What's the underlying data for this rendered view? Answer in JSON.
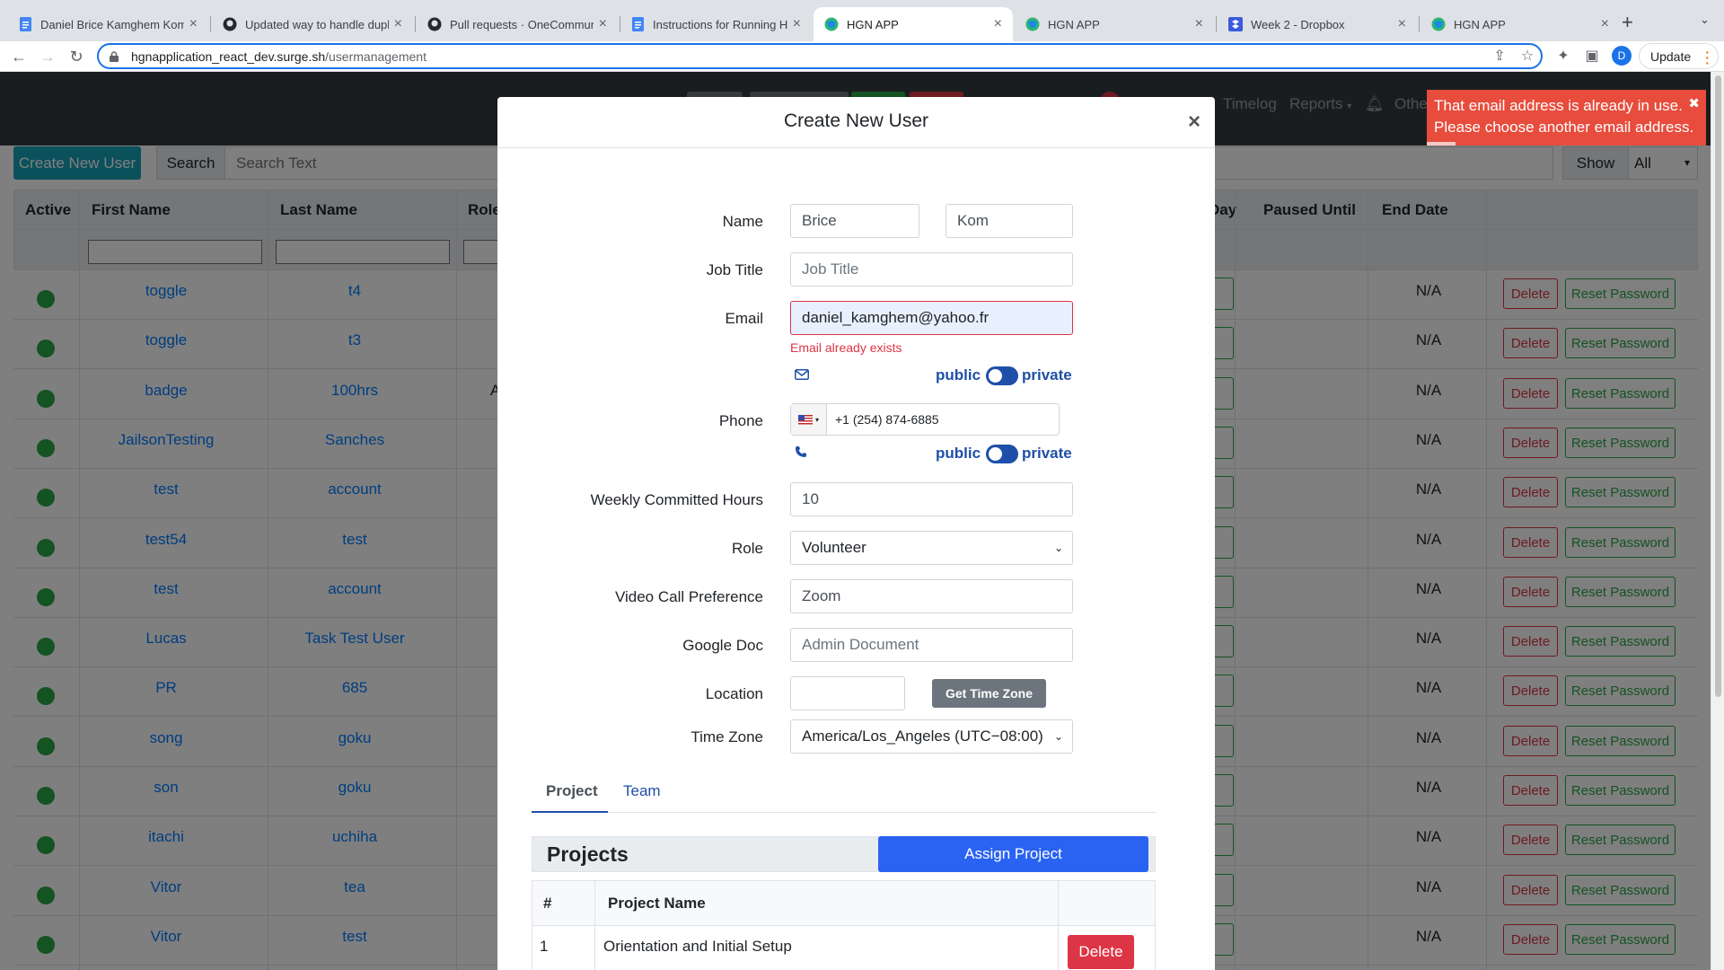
{
  "browser": {
    "tabs": [
      {
        "title": "Daniel Brice Kamghem Kom",
        "icon": "google-docs-icon",
        "active": false
      },
      {
        "title": "Updated way to handle dupl",
        "icon": "github-icon",
        "active": false
      },
      {
        "title": "Pull requests · OneCommuni",
        "icon": "github-icon",
        "active": false
      },
      {
        "title": "Instructions for Running HGI",
        "icon": "google-docs-icon",
        "active": false
      },
      {
        "title": "HGN APP",
        "icon": "hgn-globe-icon",
        "active": true
      },
      {
        "title": "HGN APP",
        "icon": "hgn-globe-icon",
        "active": false
      },
      {
        "title": "Week 2 - Dropbox",
        "icon": "dropbox-icon",
        "active": false
      },
      {
        "title": "HGN APP",
        "icon": "hgn-globe-icon",
        "active": false
      }
    ],
    "url_host": "hgnapplication_react_dev.surge.sh",
    "url_path": "/usermanagement",
    "profile_initial": "D",
    "update_label": "Update"
  },
  "nav": {
    "links": [
      "Timelog",
      "Reports",
      "Othe"
    ]
  },
  "controls": {
    "create_label": "Create New User",
    "search_label": "Search",
    "search_placeholder": "Search Text",
    "show_label": "Show",
    "show_value": "All"
  },
  "table": {
    "headers": {
      "active": "Active",
      "first": "First Name",
      "last": "Last Name",
      "role": "Role",
      "day": "Day",
      "paused": "Paused Until",
      "end": "End Date"
    },
    "rows": [
      {
        "first": "toggle",
        "last": "t4",
        "end": "N/A"
      },
      {
        "first": "toggle",
        "last": "t3",
        "end": "N/A"
      },
      {
        "first": "badge",
        "last": "100hrs",
        "end": "N/A"
      },
      {
        "first": "JailsonTesting",
        "last": "Sanches",
        "end": "N/A"
      },
      {
        "first": "test",
        "last": "account",
        "end": "N/A"
      },
      {
        "first": "test54",
        "last": "test",
        "end": "N/A"
      },
      {
        "first": "test",
        "last": "account",
        "end": "N/A"
      },
      {
        "first": "Lucas",
        "last": "Task Test User",
        "end": "N/A"
      },
      {
        "first": "PR",
        "last": "685",
        "end": "N/A"
      },
      {
        "first": "song",
        "last": "goku",
        "end": "N/A"
      },
      {
        "first": "son",
        "last": "goku",
        "end": "N/A"
      },
      {
        "first": "itachi",
        "last": "uchiha",
        "end": "N/A"
      },
      {
        "first": "Vitor",
        "last": "tea",
        "end": "N/A"
      },
      {
        "first": "Vitor",
        "last": "test",
        "end": "N/A"
      }
    ],
    "delete_label": "Delete",
    "reset_label": "Reset Password",
    "role_fragment": "A"
  },
  "modal": {
    "title": "Create New User",
    "close": "×",
    "labels": {
      "name": "Name",
      "job_title": "Job Title",
      "email": "Email",
      "phone": "Phone",
      "weekly_hours": "Weekly Committed Hours",
      "role": "Role",
      "video_pref": "Video Call Preference",
      "google_doc": "Google Doc",
      "location": "Location",
      "time_zone": "Time Zone"
    },
    "values": {
      "first_name": "Brice",
      "last_name": "Kom",
      "job_title_placeholder": "Job Title",
      "email": "daniel_kamghem@yahoo.fr",
      "email_error": "Email already exists",
      "phone": "+1 (254) 874-6885",
      "weekly_hours": "10",
      "role": "Volunteer",
      "video_pref": "Zoom",
      "google_doc_placeholder": "Admin Document",
      "location": "",
      "time_zone": "America/Los_Angeles (UTC−08:00)"
    },
    "privacy": {
      "public": "public",
      "private": "private"
    },
    "get_tz_label": "Get Time Zone",
    "tabs": [
      "Project",
      "Team"
    ],
    "projects_title": "Projects",
    "assign_label": "Assign Project",
    "project_table": {
      "headers": [
        "#",
        "Project Name"
      ],
      "rows": [
        {
          "num": "1",
          "name": "Orientation and Initial Setup"
        }
      ],
      "delete_label": "Delete"
    }
  },
  "toast": {
    "message_line1": "That email address is already in use.",
    "message_line2": "Please choose another email address."
  },
  "colors": {
    "accent": "#1f4fa8",
    "danger": "#dc3545",
    "success": "#28a745",
    "info": "#17a2b8",
    "toast": "#e74c3c"
  }
}
